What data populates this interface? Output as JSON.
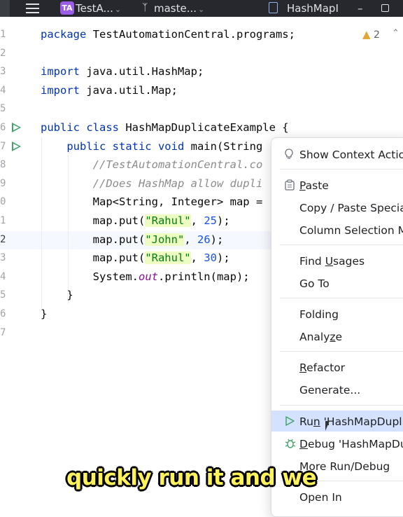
{
  "titlebar": {
    "project_badge": "TA",
    "project_name": "TestA...",
    "branch": "maste...",
    "file_tab": "HashMapI",
    "minimize": "–"
  },
  "editor": {
    "warnings_count": "2",
    "line_numbers": [
      "1",
      "2",
      "3",
      "4",
      "5",
      "6",
      "7",
      "8",
      "9",
      "0",
      "1",
      "2",
      "3",
      "4",
      "5",
      "6",
      "7"
    ],
    "lines": [
      {
        "segments": [
          {
            "t": "package ",
            "c": "kw"
          },
          {
            "t": "TestAutomationCentral.programs;",
            "c": ""
          }
        ]
      },
      {
        "segments": []
      },
      {
        "segments": [
          {
            "t": "import ",
            "c": "kw"
          },
          {
            "t": "java.util.HashMap;",
            "c": ""
          }
        ]
      },
      {
        "segments": [
          {
            "t": "import ",
            "c": "kw"
          },
          {
            "t": "java.util.Map;",
            "c": ""
          }
        ]
      },
      {
        "segments": []
      },
      {
        "segments": [
          {
            "t": "public class ",
            "c": "kw"
          },
          {
            "t": "HashMapDuplicateExample {",
            "c": ""
          }
        ]
      },
      {
        "segments": [
          {
            "t": "    public static void ",
            "c": "kw"
          },
          {
            "t": "main(String",
            "c": ""
          }
        ]
      },
      {
        "segments": [
          {
            "t": "        //TestAutomationCentral.co",
            "c": "cm"
          }
        ]
      },
      {
        "segments": [
          {
            "t": "        //Does HashMap allow dupli",
            "c": "cm"
          }
        ]
      },
      {
        "segments": [
          {
            "t": "        Map<String, Integer> map =",
            "c": ""
          }
        ]
      },
      {
        "segments": [
          {
            "t": "        map.put(",
            "c": ""
          },
          {
            "t": "\"Rahul\"",
            "c": "str"
          },
          {
            "t": ", ",
            "c": ""
          },
          {
            "t": "25",
            "c": "num"
          },
          {
            "t": ");",
            "c": ""
          }
        ]
      },
      {
        "segments": [
          {
            "t": "        map.put(",
            "c": ""
          },
          {
            "t": "\"John\"",
            "c": "str"
          },
          {
            "t": ", ",
            "c": ""
          },
          {
            "t": "26",
            "c": "num"
          },
          {
            "t": ");",
            "c": ""
          }
        ]
      },
      {
        "segments": [
          {
            "t": "        map.put(",
            "c": ""
          },
          {
            "t": "\"Rahul\"",
            "c": "str"
          },
          {
            "t": ", ",
            "c": ""
          },
          {
            "t": "30",
            "c": "num"
          },
          {
            "t": ");",
            "c": ""
          }
        ]
      },
      {
        "segments": [
          {
            "t": "        System.",
            "c": ""
          },
          {
            "t": "out",
            "c": "fld"
          },
          {
            "t": ".println(map);",
            "c": ""
          }
        ]
      },
      {
        "segments": [
          {
            "t": "    }",
            "c": ""
          }
        ]
      },
      {
        "segments": [
          {
            "t": "}",
            "c": ""
          }
        ]
      },
      {
        "segments": []
      }
    ]
  },
  "context_menu": {
    "items": [
      {
        "label": "Show Context Actio",
        "icon": "lightbulb-icon"
      },
      {
        "label": "Paste",
        "icon": "paste-icon",
        "u": 0
      },
      {
        "label": "Copy / Paste Specia",
        "icon": ""
      },
      {
        "label": "Column Selection M",
        "icon": ""
      },
      {
        "label": "Find Usages",
        "icon": "",
        "u": 5
      },
      {
        "label": "Go To",
        "icon": ""
      },
      {
        "label": "Folding",
        "icon": ""
      },
      {
        "label": "Analyze",
        "icon": "",
        "u": 5
      },
      {
        "label": "Refactor",
        "icon": "",
        "u": 0
      },
      {
        "label": "Generate...",
        "icon": ""
      },
      {
        "label": "Run 'HashMapDuplic",
        "icon": "run-icon",
        "u": 2
      },
      {
        "label": "Debug 'HashMapDup",
        "icon": "debug-icon",
        "u": 0
      },
      {
        "label": "More Run/Debug",
        "icon": ""
      },
      {
        "label": "Open In",
        "icon": ""
      }
    ]
  },
  "caption": "quickly run it and we",
  "colors": {
    "accent_selected": "#d4e2ff",
    "caption": "#fff25a",
    "run_green": "#3fa46a"
  }
}
